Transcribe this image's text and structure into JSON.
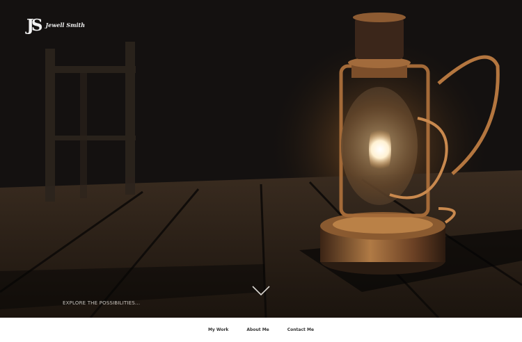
{
  "brand": {
    "monogram": "JS",
    "name": "Jewell Smith"
  },
  "hero": {
    "tagline": "EXPLORE THE POSSIBILITIES...",
    "image": "lantern-on-wooden-floor"
  },
  "nav": {
    "items": [
      {
        "label": "My Work"
      },
      {
        "label": "About Me"
      },
      {
        "label": "Contact Me"
      }
    ]
  },
  "icons": {
    "scroll": "chevron-down-icon"
  },
  "colors": {
    "hero_dark": "#070606",
    "lantern_glow": "#f3c27a",
    "text_light": "#c9c5bf",
    "nav_text": "#333333"
  }
}
